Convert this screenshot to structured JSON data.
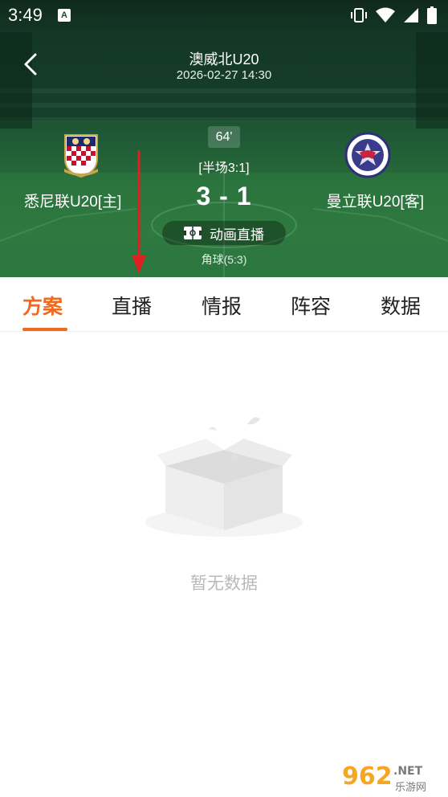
{
  "status_bar": {
    "time": "3:49",
    "notification_icon": "a-badge-icon",
    "icons": [
      "vibrate-icon",
      "wifi-icon",
      "signal-icon",
      "battery-icon"
    ]
  },
  "header": {
    "title": "澳威北U20",
    "datetime": "2026-02-27 14:30"
  },
  "match": {
    "minute": "64'",
    "halftime": "[半场3:1]",
    "score": "3 - 1",
    "animation_label": "动画直播",
    "corners": "角球(5:3)",
    "home_team": "悉尼联U20[主]",
    "away_team": "曼立联U20[客]"
  },
  "tabs": [
    {
      "label": "方案",
      "active": true
    },
    {
      "label": "直播",
      "active": false
    },
    {
      "label": "情报",
      "active": false
    },
    {
      "label": "阵容",
      "active": false
    },
    {
      "label": "数据",
      "active": false
    }
  ],
  "empty_state": {
    "text": "暂无数据"
  },
  "colors": {
    "accent": "#f0691e",
    "hero_green": "#1f5a35",
    "arrow_red": "#e02020",
    "empty_text": "#b9b9b9"
  }
}
